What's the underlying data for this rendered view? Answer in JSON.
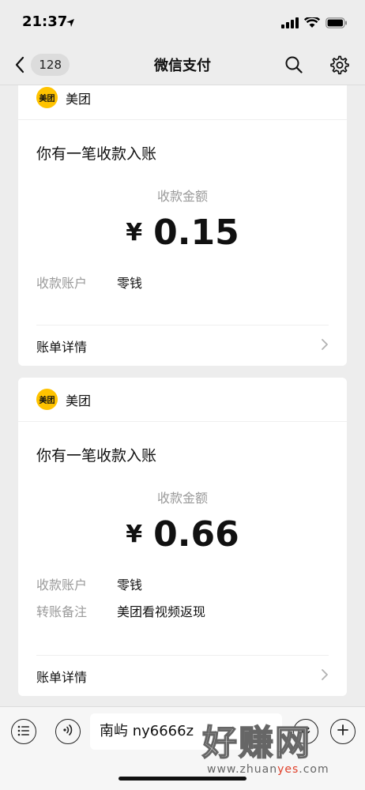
{
  "status_bar": {
    "time": "21:37"
  },
  "nav": {
    "unread_count": "128",
    "title": "微信支付"
  },
  "cards": [
    {
      "merchant_logo_text": "美团",
      "merchant_name": "美团",
      "title": "你有一笔收款入账",
      "amount_label": "收款金额",
      "currency": "¥",
      "amount": "0.15",
      "rows": [
        {
          "key": "收款账户",
          "value": "零钱"
        }
      ],
      "detail_label": "账单详情"
    },
    {
      "merchant_logo_text": "美团",
      "merchant_name": "美团",
      "title": "你有一笔收款入账",
      "amount_label": "收款金额",
      "currency": "¥",
      "amount": "0.66",
      "rows": [
        {
          "key": "收款账户",
          "value": "零钱"
        },
        {
          "key": "转账备注",
          "value": "美团看视频返现"
        }
      ],
      "detail_label": "账单详情"
    }
  ],
  "input_bar": {
    "text": "南屿 ny6666z"
  },
  "watermark": {
    "main": "好赚网",
    "sub_prefix": "www.zhuan",
    "sub_accent": "yes",
    "sub_suffix": ".com"
  },
  "colors": {
    "background": "#ededed",
    "logo_yellow": "#ffc300",
    "muted_text": "#9a9a9a"
  },
  "icons": [
    "location-arrow-icon",
    "signal-icon",
    "wifi-icon",
    "battery-icon",
    "chevron-left-icon",
    "search-icon",
    "gear-icon",
    "chevron-right-icon",
    "menu-list-icon",
    "voice-icon",
    "emoji-icon",
    "plus-icon"
  ]
}
